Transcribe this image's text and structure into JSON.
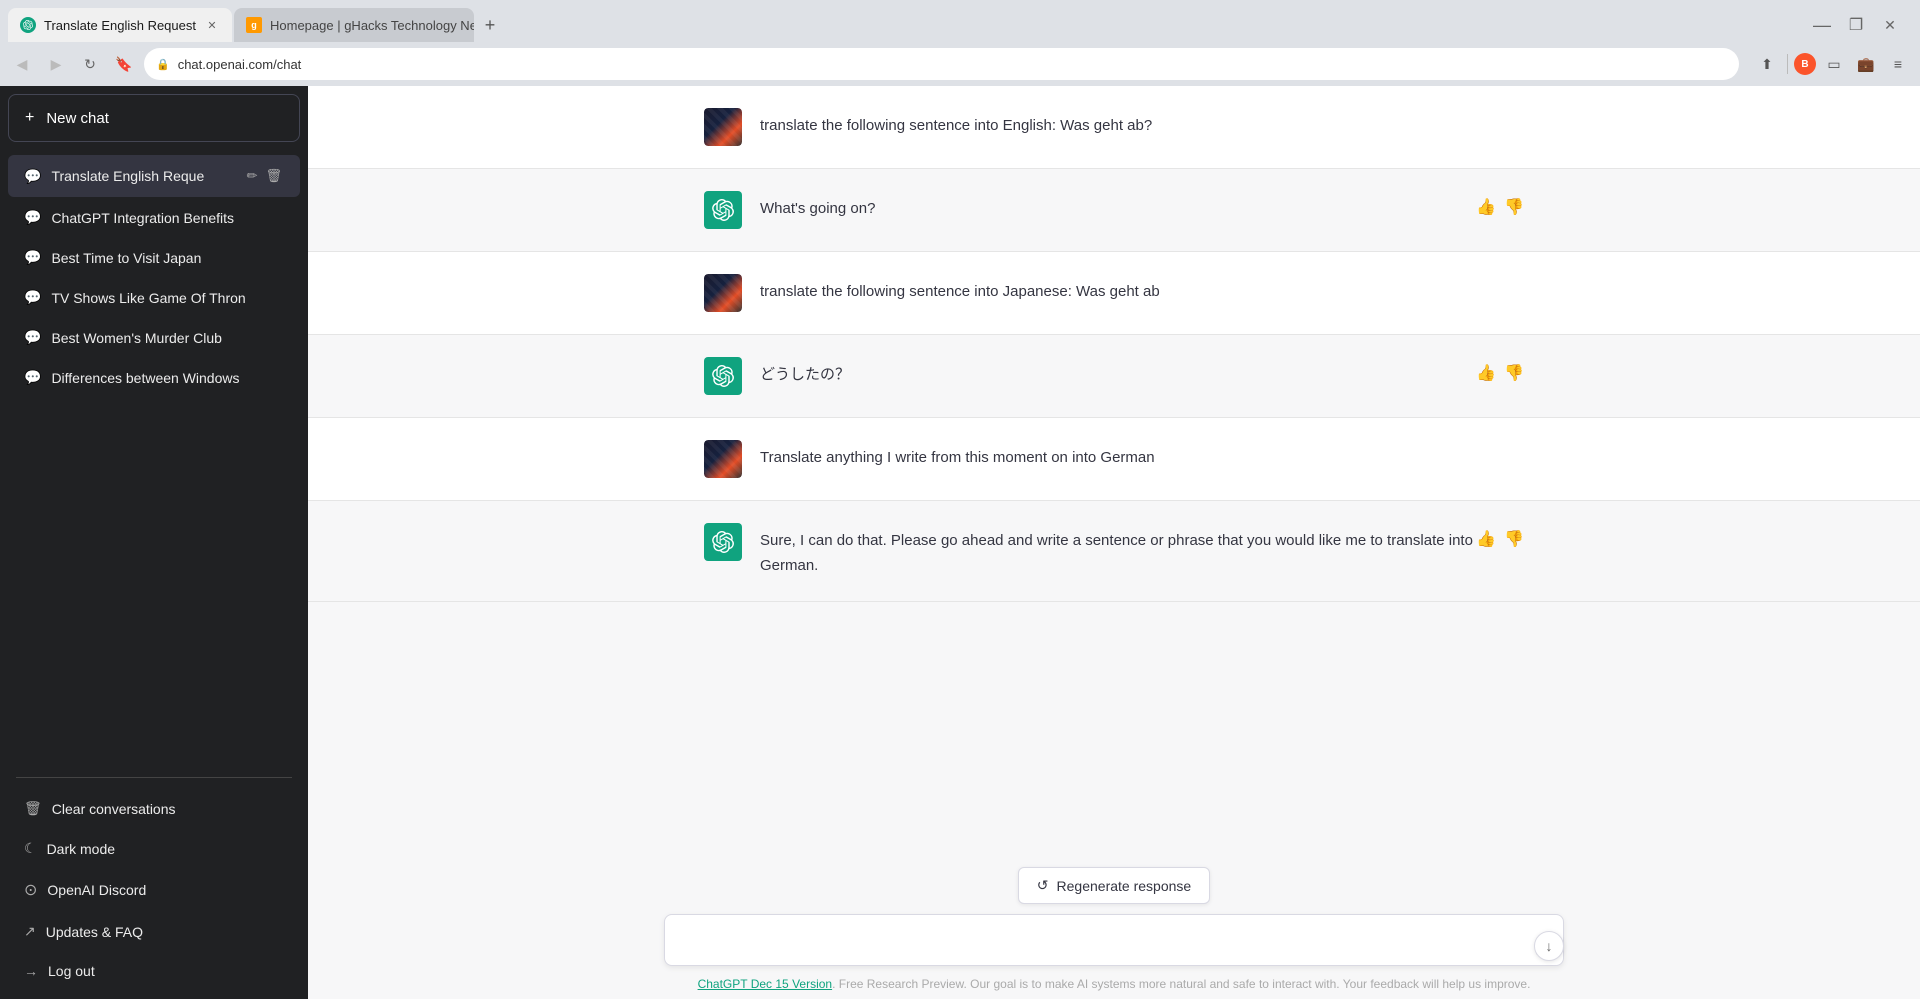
{
  "browser": {
    "tabs": [
      {
        "id": "chatgpt",
        "title": "Translate English Request",
        "url": "chat.openai.com/chat",
        "active": true,
        "favicon_type": "chatgpt"
      },
      {
        "id": "ghacks",
        "title": "Homepage | gHacks Technology News",
        "url": "ghacks.net",
        "active": false,
        "favicon_type": "ghacks"
      }
    ],
    "address": "chat.openai.com/chat"
  },
  "sidebar": {
    "new_chat_label": "New chat",
    "conversations": [
      {
        "id": "translate-english",
        "label": "Translate English Reque",
        "active": true
      },
      {
        "id": "chatgpt-integration",
        "label": "ChatGPT Integration Benefits",
        "active": false
      },
      {
        "id": "japan",
        "label": "Best Time to Visit Japan",
        "active": false
      },
      {
        "id": "tv-shows",
        "label": "TV Shows Like Game Of Thron",
        "active": false
      },
      {
        "id": "murder-club",
        "label": "Best Women's Murder Club",
        "active": false
      },
      {
        "id": "windows-diff",
        "label": "Differences between Windows",
        "active": false
      }
    ],
    "bottom_items": [
      {
        "id": "clear",
        "icon": "🗑",
        "label": "Clear conversations"
      },
      {
        "id": "dark-mode",
        "icon": "☾",
        "label": "Dark mode"
      },
      {
        "id": "discord",
        "icon": "◉",
        "label": "OpenAI Discord"
      },
      {
        "id": "updates",
        "icon": "↗",
        "label": "Updates & FAQ"
      },
      {
        "id": "logout",
        "icon": "→",
        "label": "Log out"
      }
    ]
  },
  "chat": {
    "messages": [
      {
        "id": 1,
        "role": "user",
        "text": "translate the following sentence into English: Was geht ab?",
        "has_actions": false
      },
      {
        "id": 2,
        "role": "assistant",
        "text": "What's going on?",
        "has_actions": true
      },
      {
        "id": 3,
        "role": "user",
        "text": "translate the following sentence into Japanese: Was geht ab",
        "has_actions": false
      },
      {
        "id": 4,
        "role": "assistant",
        "text": "どうしたの？",
        "has_actions": true
      },
      {
        "id": 5,
        "role": "user",
        "text": "Translate anything I write from this moment on into German",
        "has_actions": false
      },
      {
        "id": 6,
        "role": "assistant",
        "text": "Sure, I can do that. Please go ahead and write a sentence or phrase that you would like me to translate into German.",
        "has_actions": true
      }
    ],
    "regenerate_label": "Regenerate response",
    "input_placeholder": "",
    "footer_link_text": "ChatGPT Dec 15 Version",
    "footer_text": ". Free Research Preview. Our goal is to make AI systems more natural and safe to interact with. Your feedback will help us improve."
  }
}
